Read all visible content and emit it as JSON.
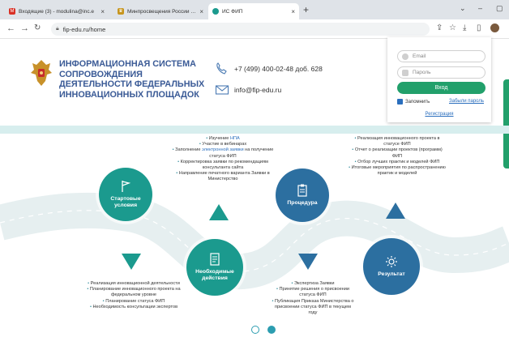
{
  "browser": {
    "tabs": [
      {
        "title": "Входящие (3) - modulina@inc.e",
        "icon": "gmail-icon",
        "active": false
      },
      {
        "title": "Минпросвещения России объ",
        "icon": "gov-emblem-icon",
        "active": false
      },
      {
        "title": "ИС ФИП",
        "icon": "fip-icon",
        "active": true
      }
    ],
    "new_tab": "+",
    "url": "fip-edu.ru/home",
    "window_controls": [
      "⌄",
      "–",
      "▢"
    ]
  },
  "header": {
    "title": "Информационная система сопровождения деятельности федеральных инновационных площадок",
    "phone": "+7 (499) 400-02-48 доб. 628",
    "email": "info@fip-edu.ru"
  },
  "login": {
    "email_placeholder": "Email",
    "password_placeholder": "Пароль",
    "submit": "Вход",
    "remember": "Запомнить",
    "forgot": "Забыли пароль",
    "register": "Регистрация"
  },
  "roadmap": {
    "steps": [
      {
        "label": "Стартовые условия"
      },
      {
        "label": "Необходимые действия"
      },
      {
        "label": "Процедура"
      },
      {
        "label": "Результат"
      }
    ],
    "lists": {
      "top1": [
        "Изучение НПА",
        "Участие в вебинарах",
        "Заполнение электронной заявки на получение статуса ФИП",
        "Корректировка заявки по рекомендациям консультанта сайта",
        "Направление печатного варианта Заявки в Министерство"
      ],
      "top2": [
        "Реализация инновационного проекта в статусе ФИП",
        "Отчет о реализации проектов (программ) ФИП",
        "Отбор лучших практик и моделей ФИП",
        "Итоговые мероприятия по распространению практик и моделей"
      ],
      "bottom1": [
        "Реализация инновационной деятельности",
        "Планирование инновационного проекта на федеральном уровне",
        "Планирование статуса ФИП",
        "Необходимость консультации экспертов"
      ],
      "bottom2": [
        "Экспертиза Заявки",
        "Принятие решения о присвоении статуса ФИП",
        "Публикация Приказа Министерства о присвоении статуса ФИП в текущем году"
      ]
    },
    "highlight": {
      "npa": "НПА",
      "zayavka": "электронной заявки"
    },
    "colors": {
      "teal": "#1b9a8e",
      "blue": "#2c6fa0",
      "road": "#e4eff0"
    }
  },
  "pagination": {
    "count": 2,
    "active": 1
  }
}
